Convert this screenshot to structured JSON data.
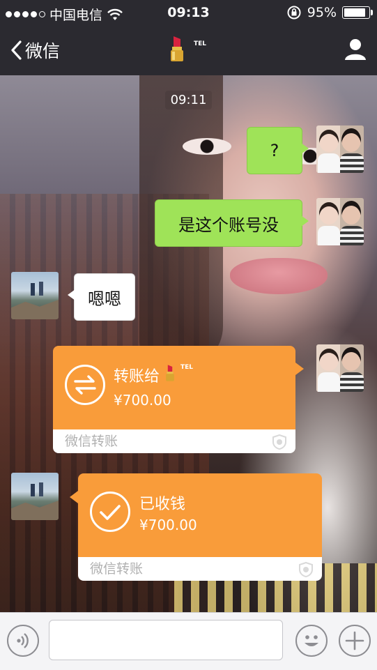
{
  "status_bar": {
    "carrier": "中国电信",
    "time": "09:13",
    "battery": "95%",
    "battery_level": 0.95
  },
  "nav": {
    "back_label": "微信",
    "title_tel": "TEL",
    "contact_icon": "lipstick-icon",
    "profile_icon": "person-icon"
  },
  "chat": {
    "timestamp": "09:11",
    "messages": [
      {
        "side": "right",
        "type": "text",
        "text": "?"
      },
      {
        "side": "right",
        "type": "text",
        "text": "是这个账号没"
      },
      {
        "side": "left",
        "type": "text",
        "text": "嗯嗯"
      },
      {
        "side": "right",
        "type": "transfer",
        "title": "转账给",
        "tel": "TEL",
        "amount": "¥700.00",
        "footer": "微信转账"
      },
      {
        "side": "left",
        "type": "transfer",
        "title": "已收钱",
        "amount": "¥700.00",
        "footer": "微信转账"
      }
    ]
  },
  "input_bar": {
    "voice_icon": "voice-icon",
    "emoji_icon": "emoji-icon",
    "plus_icon": "plus-icon",
    "placeholder": ""
  },
  "colors": {
    "bar_bg": "#2b2a30",
    "green_bubble": "#9fe358",
    "transfer_orange": "#f99c3a"
  }
}
